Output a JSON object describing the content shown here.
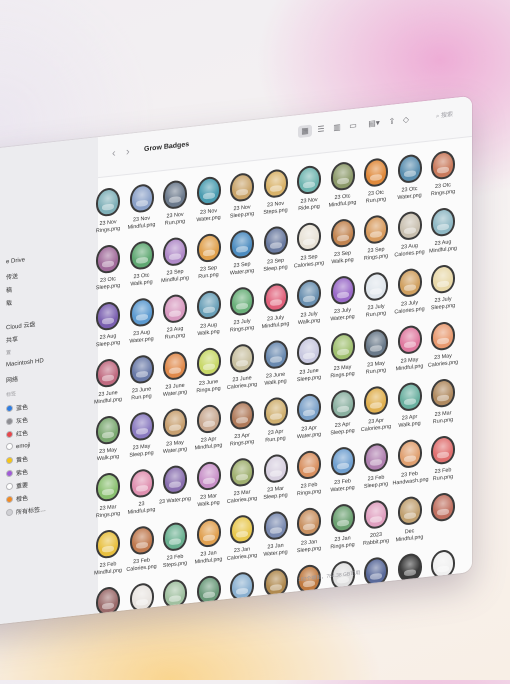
{
  "window": {
    "title": "Grow Badges",
    "nav_back": "‹",
    "nav_forward": "›",
    "search_placeholder": "搜索",
    "status_bar": "182个项目，784.38 GB可用",
    "toolbar_icons": [
      "icon-view-icon",
      "list-view-icon",
      "column-view-icon",
      "gallery-view-icon",
      "group-icon",
      "share-icon",
      "tag-icon",
      "more-icon"
    ]
  },
  "sidebar": {
    "items": [
      {
        "label": "e Drive",
        "kind": "item"
      },
      {
        "label": "传送",
        "kind": "item"
      },
      {
        "label": "稿",
        "kind": "item"
      },
      {
        "label": "载",
        "kind": "item"
      },
      {
        "label": "Cloud 云盘",
        "kind": "item"
      },
      {
        "label": "共享",
        "kind": "item"
      },
      {
        "label": "置",
        "kind": "head"
      },
      {
        "label": "Macintosh HD",
        "kind": "item"
      },
      {
        "label": "网络",
        "kind": "item"
      },
      {
        "label": "标签",
        "kind": "head"
      },
      {
        "label": "蓝色",
        "kind": "tag",
        "color": "#2f7de1"
      },
      {
        "label": "灰色",
        "kind": "tag",
        "color": "#8e8e93"
      },
      {
        "label": "红色",
        "kind": "tag",
        "color": "#e5484d"
      },
      {
        "label": "emoji",
        "kind": "tag",
        "color": "#ffffff"
      },
      {
        "label": "黄色",
        "kind": "tag",
        "color": "#f5c518"
      },
      {
        "label": "紫色",
        "kind": "tag",
        "color": "#a05cd6"
      },
      {
        "label": "重要",
        "kind": "tag",
        "color": "#ffffff"
      },
      {
        "label": "橙色",
        "kind": "tag",
        "color": "#f08a24"
      },
      {
        "label": "所有标签…",
        "kind": "tag",
        "color": "#d0d0d4"
      }
    ]
  },
  "files": [
    {
      "name": "23 Nov Rings.png",
      "color": "#7fb0b8"
    },
    {
      "name": "23 Nov Mindful.png",
      "color": "#8aa0c8"
    },
    {
      "name": "23 Nov Run.png",
      "color": "#6c7a8c"
    },
    {
      "name": "23 Nov Water.png",
      "color": "#4a9cb0"
    },
    {
      "name": "23 Nov Sleep.png",
      "color": "#c9a46a"
    },
    {
      "name": "23 Nov Steps.png",
      "color": "#d9b36a"
    },
    {
      "name": "23 Nov Ride.png",
      "color": "#6fb5b0"
    },
    {
      "name": "23 Otc Mindful.png",
      "color": "#8c9a6a"
    },
    {
      "name": "23 Otc Run.png",
      "color": "#e08a3c"
    },
    {
      "name": "23 Otc Water.png",
      "color": "#5b8fb0"
    },
    {
      "name": "23 Otc Rings.png",
      "color": "#c97a5c"
    },
    {
      "name": "23 Otc Sleep.png",
      "color": "#a06a9a"
    },
    {
      "name": "23 Otc Walk.png",
      "color": "#5fa872"
    },
    {
      "name": "23 Sep Mindful.png",
      "color": "#b08ac8"
    },
    {
      "name": "23 Sep Run.png",
      "color": "#e0a04c"
    },
    {
      "name": "23 Sep Water.png",
      "color": "#4c8cc0"
    },
    {
      "name": "23 Sep Sleep.png",
      "color": "#6a7aa0"
    },
    {
      "name": "23 Sep Calories.png",
      "color": "#e8e2d6"
    },
    {
      "name": "23 Sep Walk.png",
      "color": "#c28450"
    },
    {
      "name": "23 Sep Rings.png",
      "color": "#d89b5e"
    },
    {
      "name": "23 Aug Calories.png",
      "color": "#c9c0b0"
    },
    {
      "name": "23 Aug Mindful.png",
      "color": "#8fb8c4"
    },
    {
      "name": "23 Aug Sleep.png",
      "color": "#7a5fb0"
    },
    {
      "name": "23 Aug Water.png",
      "color": "#5c9ad0"
    },
    {
      "name": "23 Aug Run.png",
      "color": "#d89ac0"
    },
    {
      "name": "23 Aug Walk.png",
      "color": "#6aa0b8"
    },
    {
      "name": "23 July Rings.png",
      "color": "#6ab07a"
    },
    {
      "name": "23 July Mindful.png",
      "color": "#e0607a"
    },
    {
      "name": "23 July Walk.png",
      "color": "#6a90b0"
    },
    {
      "name": "23 July Water.png",
      "color": "#9a6ac8"
    },
    {
      "name": "23 July Run.png",
      "color": "#e0e6ec"
    },
    {
      "name": "23 July Calories.png",
      "color": "#d0a060"
    },
    {
      "name": "23 July Sleep.png",
      "color": "#e8d8a8"
    },
    {
      "name": "23 June Mindful.png",
      "color": "#c06a80"
    },
    {
      "name": "23 June Run.png",
      "color": "#6a7aa8"
    },
    {
      "name": "23 June Water.png",
      "color": "#e08a4c"
    },
    {
      "name": "23 June Rings.png",
      "color": "#c8d868"
    },
    {
      "name": "23 June Calories.png",
      "color": "#c8c0a0"
    },
    {
      "name": "23 June Walk.png",
      "color": "#6a8ab0"
    },
    {
      "name": "23 June Sleep.png",
      "color": "#c8c8e0"
    },
    {
      "name": "23 May Rings.png",
      "color": "#a0c070"
    },
    {
      "name": "23 May Run.png",
      "color": "#6a7a8a"
    },
    {
      "name": "23 May Mindful.png",
      "color": "#e07aa0"
    },
    {
      "name": "23 May Calories.png",
      "color": "#e89a70"
    },
    {
      "name": "23 May Walk.png",
      "color": "#7aa870"
    },
    {
      "name": "23 May Sleep.png",
      "color": "#8a7ac0"
    },
    {
      "name": "23 May Water.png",
      "color": "#c8a070"
    },
    {
      "name": "23 Apr Mindful.png",
      "color": "#c8a890"
    },
    {
      "name": "23 Apr Rings.png",
      "color": "#b07a5a"
    },
    {
      "name": "23 Apr Run.png",
      "color": "#d0b070"
    },
    {
      "name": "23 Apr Water.png",
      "color": "#7aa0c8"
    },
    {
      "name": "23 Apr Sleep.png",
      "color": "#8ab0a0"
    },
    {
      "name": "23 Apr Calories.png",
      "color": "#e0b050"
    },
    {
      "name": "23 Apr Walk.png",
      "color": "#6ab0a0"
    },
    {
      "name": "23 Mar Run.png",
      "color": "#b08a60"
    },
    {
      "name": "23 Mar Rings.png",
      "color": "#8ac070"
    },
    {
      "name": "23 Mindful.png",
      "color": "#e090b0"
    },
    {
      "name": "23 Water.png",
      "color": "#8a70b0"
    },
    {
      "name": "23 Mar Walk.png",
      "color": "#c890c8"
    },
    {
      "name": "23 Mar Calories.png",
      "color": "#a0b070"
    },
    {
      "name": "23 Mar Sleep.png",
      "color": "#d8d0e0"
    },
    {
      "name": "23 Feb Rings.png",
      "color": "#d89060"
    },
    {
      "name": "23 Feb Water.png",
      "color": "#70a0d0"
    },
    {
      "name": "23 Feb Sleep.png",
      "color": "#b080b0"
    },
    {
      "name": "23 Feb Handwash.png",
      "color": "#e0a070"
    },
    {
      "name": "23 Feb Run.png",
      "color": "#e07070"
    },
    {
      "name": "23 Feb Mindful.png",
      "color": "#e8c040"
    },
    {
      "name": "23 Feb Calories.png",
      "color": "#c07a50"
    },
    {
      "name": "23 Feb Steps.png",
      "color": "#6ab090"
    },
    {
      "name": "23 Jan Mindful.png",
      "color": "#e0a050"
    },
    {
      "name": "23 Jan Calories.png",
      "color": "#e8c850"
    },
    {
      "name": "23 Jan Water.png",
      "color": "#7a8ab0"
    },
    {
      "name": "23 Jan Sleep.png",
      "color": "#c89060"
    },
    {
      "name": "23 Jan Rings.png",
      "color": "#6aa070"
    },
    {
      "name": "2023 Rabbit.png",
      "color": "#e0a0c0"
    },
    {
      "name": "Dec Mindful.png",
      "color": "#c0a070"
    },
    {
      "name": "",
      "color": "#c07060"
    },
    {
      "name": "",
      "color": "#9a6a6a"
    },
    {
      "name": "",
      "color": "#e8e4e0"
    },
    {
      "name": "",
      "color": "#a0c0a0"
    },
    {
      "name": "",
      "color": "#6a9a7a"
    },
    {
      "name": "",
      "color": "#8ab0d0"
    },
    {
      "name": "",
      "color": "#b08a50"
    },
    {
      "name": "",
      "color": "#c07a40"
    },
    {
      "name": "",
      "color": "#e0e0e0"
    },
    {
      "name": "",
      "color": "#5a6a9a"
    },
    {
      "name": "",
      "color": "#3a3a3a"
    },
    {
      "name": "",
      "color": "#f0f0f0"
    }
  ]
}
